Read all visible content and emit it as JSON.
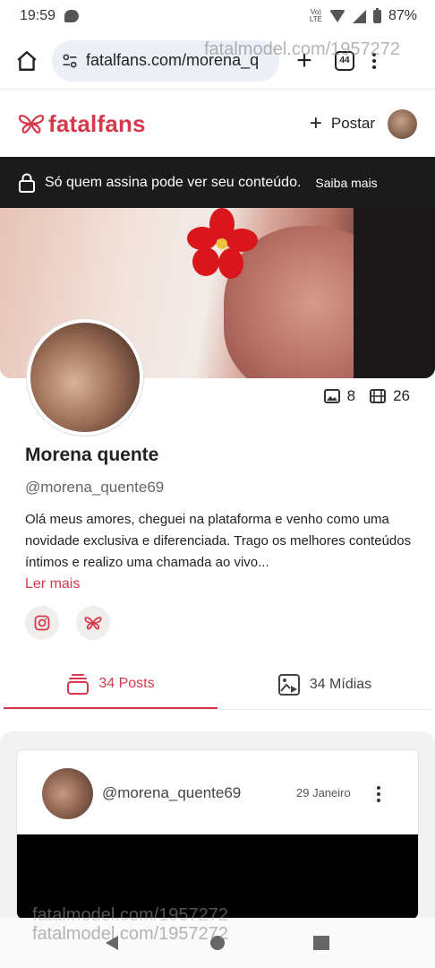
{
  "status_bar": {
    "time": "19:59",
    "network_top": "Vo)",
    "network_bottom": "LTE",
    "battery": "87%"
  },
  "browser": {
    "url": "fatalfans.com/morena_q",
    "tab_count": "44"
  },
  "watermarks": {
    "text": "fatalmodel.com/1957272"
  },
  "site": {
    "logo_text": "fatalfans",
    "post_label": "Postar"
  },
  "banner": {
    "text": "Só quem assina pode ver seu conteúdo.",
    "learn_more": "Saiba mais"
  },
  "profile": {
    "photo_count": "8",
    "video_count": "26",
    "name": "Morena quente",
    "handle": "@morena_quente69",
    "bio": "Olá meus amores, cheguei na plataforma e venho como uma novidade exclusiva e diferenciada. Trago os melhores conteúdos íntimos e realizo uma chamada ao vivo...",
    "read_more": "Ler mais"
  },
  "tabs": {
    "posts": "34 Posts",
    "media": "34 Mídias"
  },
  "post": {
    "handle": "@morena_quente69",
    "date": "29 Janeiro"
  },
  "colors": {
    "accent": "#d6394b",
    "banner": "#1b1b1b"
  }
}
